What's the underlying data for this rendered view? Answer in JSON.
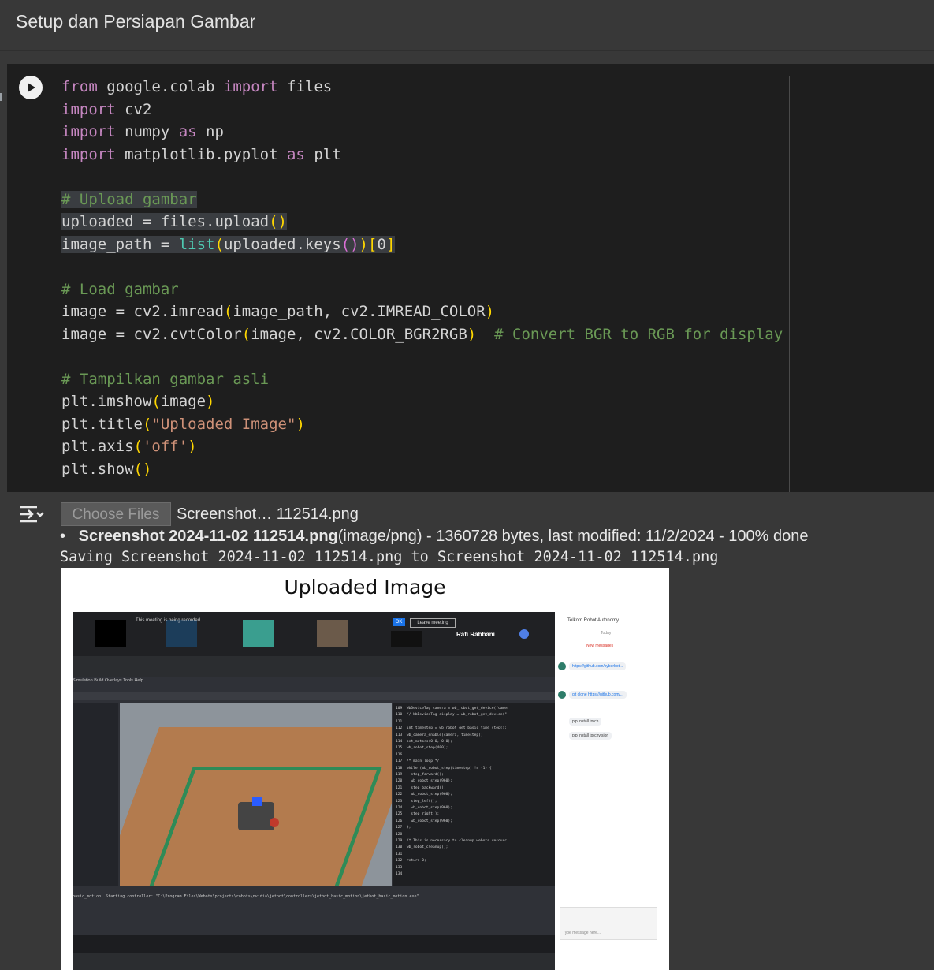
{
  "section": {
    "title": "Setup dan Persiapan Gambar"
  },
  "code_cell": {
    "lines": [
      {
        "t": [
          [
            "kw",
            "from"
          ],
          [
            "fn",
            " google.colab "
          ],
          [
            "kw",
            "import"
          ],
          [
            "fn",
            " files"
          ]
        ]
      },
      {
        "t": [
          [
            "kw",
            "import"
          ],
          [
            "fn",
            " cv2"
          ]
        ]
      },
      {
        "t": [
          [
            "kw",
            "import"
          ],
          [
            "fn",
            " numpy "
          ],
          [
            "kw",
            "as"
          ],
          [
            "fn",
            " np"
          ]
        ]
      },
      {
        "t": [
          [
            "kw",
            "import"
          ],
          [
            "fn",
            " matplotlib.pyplot "
          ],
          [
            "kw",
            "as"
          ],
          [
            "fn",
            " plt"
          ]
        ]
      },
      {
        "t": []
      },
      {
        "t": [
          [
            "cm sel",
            "# Upload gambar"
          ]
        ]
      },
      {
        "t": [
          [
            "fn sel",
            "uploaded = files.upload"
          ],
          [
            "br sel",
            "()"
          ]
        ]
      },
      {
        "t": [
          [
            "fn sel",
            "image_path = "
          ],
          [
            "bi sel",
            "list"
          ],
          [
            "br sel",
            "("
          ],
          [
            "fn sel",
            "uploaded.keys"
          ],
          [
            "br2 sel",
            "()"
          ],
          [
            "br sel",
            ")"
          ],
          [
            "br sel",
            "["
          ],
          [
            "fn sel",
            "0"
          ],
          [
            "br sel",
            "]"
          ]
        ]
      },
      {
        "t": []
      },
      {
        "t": [
          [
            "cm",
            "# Load gambar"
          ]
        ]
      },
      {
        "t": [
          [
            "fn",
            "image = cv2.imread"
          ],
          [
            "br",
            "("
          ],
          [
            "fn",
            "image_path, cv2.IMREAD_COLOR"
          ],
          [
            "br",
            ")"
          ]
        ]
      },
      {
        "t": [
          [
            "fn",
            "image = cv2.cvtColor"
          ],
          [
            "br",
            "("
          ],
          [
            "fn",
            "image, cv2.COLOR_BGR2RGB"
          ],
          [
            "br",
            ")"
          ],
          [
            "fn",
            "  "
          ],
          [
            "cm",
            "# Convert BGR to RGB for display"
          ]
        ]
      },
      {
        "t": []
      },
      {
        "t": [
          [
            "cm",
            "# Tampilkan gambar asli"
          ]
        ]
      },
      {
        "t": [
          [
            "fn",
            "plt.imshow"
          ],
          [
            "br",
            "("
          ],
          [
            "fn",
            "image"
          ],
          [
            "br",
            ")"
          ]
        ]
      },
      {
        "t": [
          [
            "fn",
            "plt.title"
          ],
          [
            "br",
            "("
          ],
          [
            "st",
            "\"Uploaded Image\""
          ],
          [
            "br",
            ")"
          ]
        ]
      },
      {
        "t": [
          [
            "fn",
            "plt.axis"
          ],
          [
            "br",
            "("
          ],
          [
            "st",
            "'off'"
          ],
          [
            "br",
            ")"
          ]
        ]
      },
      {
        "t": [
          [
            "fn",
            "plt.show"
          ],
          [
            "br",
            "()"
          ]
        ]
      }
    ]
  },
  "output": {
    "choose_files_label": "Choose Files",
    "selected_file": "Screenshot… 112514.png",
    "file_bold": "Screenshot 2024-11-02 112514.png",
    "file_meta": "(image/png) - 1360728 bytes, last modified: 11/2/2024 - 100% done",
    "saving_text": "Saving Screenshot 2024-11-02 112514.png to Screenshot 2024-11-02 112514.png",
    "plot_title": "Uploaded Image"
  },
  "embedded_screenshot": {
    "recording_banner": "This meeting is being recorded.",
    "ok_label": "OK",
    "leave_label": "Leave meeting",
    "presenter": "Rafi Rabbani",
    "chat_title": "Telkom Robot Autonomy",
    "chat_today": "Today",
    "chat_new": "New messages",
    "chat_messages": [
      "https://github.com/cyberbot...",
      "git clone https://github.com/...",
      "pip install torch",
      "pip install torchvision"
    ],
    "chat_placeholder": "Type message here...",
    "ide_menu": "Simulation  Build  Overlays  Tools  Help",
    "code_lines": [
      "109  WbDeviceTag camera = wb_robot_get_device(\"camer",
      "110  // WbDeviceTag display = wb_robot_get_device(\"",
      "111",
      "112  int timestep = wb_robot_get_basic_time_step();",
      "113  wb_camera_enable(camera, timestep);",
      "114  set_motors(0.0, 0.0);",
      "115  wb_robot_step(400);",
      "116",
      "117  /* main loop */",
      "118  while (wb_robot_step(timestep) != -1) {",
      "119    step_forward();",
      "120    wb_robot_step(960);",
      "121    step_backward();",
      "122    wb_robot_step(960);",
      "123    step_left();",
      "124    wb_robot_step(960);",
      "125    step_right();",
      "126    wb_robot_step(960);",
      "127  };",
      "128",
      "129  /* This is necessary to cleanup webots resourc",
      "130  wb_robot_cleanup();",
      "131",
      "132  return 0;",
      "133",
      "134"
    ],
    "console_text": "basic_motion: Starting controller: \"C:\\Program Files\\Webots\\projects\\robots\\nvidia\\jetbot\\controllers\\jetbot_basic_motion\\jetbot_basic_motion.exe\""
  }
}
